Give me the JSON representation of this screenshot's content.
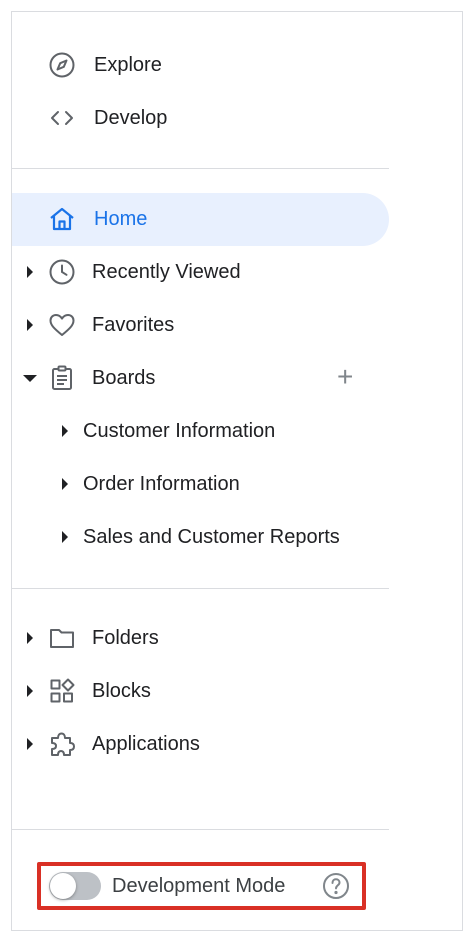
{
  "nav_top": {
    "explore_label": "Explore",
    "develop_label": "Develop"
  },
  "main_nav": {
    "home_label": "Home",
    "recently_viewed_label": "Recently Viewed",
    "favorites_label": "Favorites",
    "boards_label": "Boards",
    "boards_add_symbol": "+",
    "boards": [
      "Customer Information",
      "Order Information",
      "Sales and Customer Reports"
    ]
  },
  "content_nav": {
    "folders_label": "Folders",
    "blocks_label": "Blocks",
    "applications_label": "Applications"
  },
  "footer": {
    "development_mode_label": "Development Mode",
    "development_mode_on": false
  },
  "colors": {
    "accent": "#1a73e8",
    "home_highlight": "#e8f0fe",
    "annotation_border": "#d93025",
    "icon_gray": "#5f6368"
  },
  "icons": {
    "explore": "compass-icon",
    "develop": "code-icon",
    "home": "home-icon",
    "recently_viewed": "clock-icon",
    "favorites": "heart-icon",
    "boards": "clipboard-icon",
    "folders": "folder-icon",
    "blocks": "blocks-icon",
    "applications": "puzzle-icon",
    "help": "help-circle-icon"
  }
}
